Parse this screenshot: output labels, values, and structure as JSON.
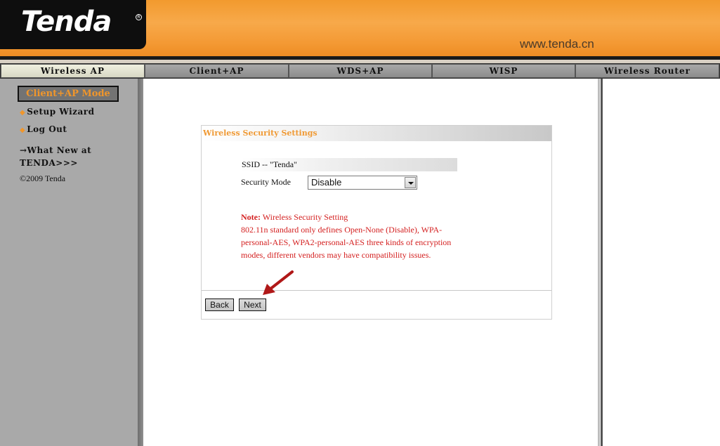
{
  "header": {
    "logo_text": "Tenda",
    "logo_mark": "R",
    "site_url": "www.tenda.cn"
  },
  "tabs": [
    {
      "label": "Wireless AP",
      "active": true
    },
    {
      "label": "Client+AP",
      "active": false
    },
    {
      "label": "WDS+AP",
      "active": false
    },
    {
      "label": "WISP",
      "active": false
    },
    {
      "label": "Wireless Router",
      "active": false
    }
  ],
  "sidebar": {
    "mode_label": "Client+AP Mode",
    "bullet": "◆",
    "setup_wizard": "Setup Wizard",
    "log_out": "Log Out",
    "whats_new": "→What New at TENDA>>>",
    "copyright": "©2009 Tenda"
  },
  "panel": {
    "title": "Wireless Security Settings",
    "ssid_text": "SSID -- \"Tenda\"",
    "security_mode_label": "Security Mode",
    "security_mode_value": "Disable",
    "note_label": "Note:",
    "note_heading": "Wireless Security Setting",
    "note_body": "802.11n standard only defines Open-None (Disable), WPA-personal-AES, WPA2-personal-AES three kinds of encryption modes, different vendors may have compatibility issues.",
    "back_label": "Back",
    "next_label": "Next"
  },
  "colors": {
    "brand_orange": "#f29a2e",
    "note_red": "#d42020",
    "annotation_arrow": "#b01818"
  }
}
